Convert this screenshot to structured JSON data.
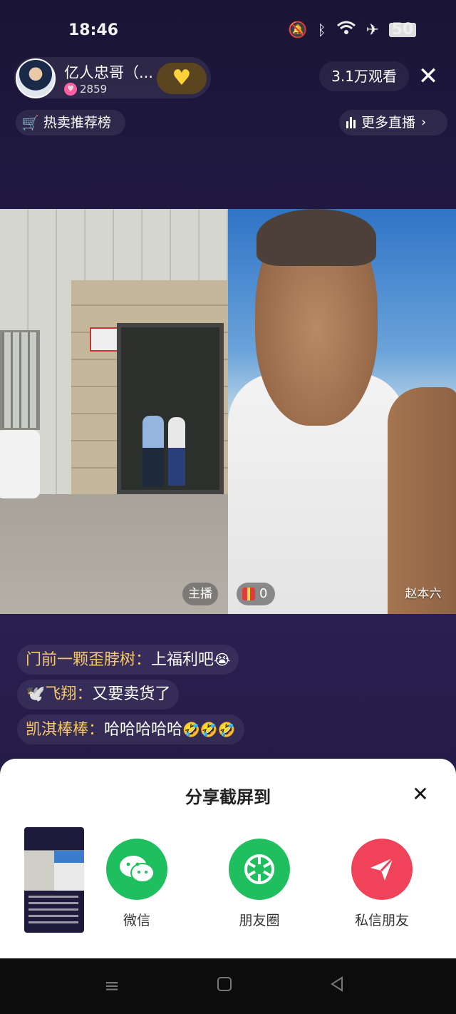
{
  "status_bar": {
    "time": "18:46",
    "battery": "50",
    "icons": [
      "mute-icon",
      "bluetooth-icon",
      "wifi-icon",
      "airplane-icon",
      "battery-icon"
    ]
  },
  "host": {
    "name": "亿人忠哥（...",
    "likes": "2859",
    "follow_icon": "heart-plus-icon"
  },
  "viewers": "3.1万观看",
  "hot_rank": "热卖推荐榜",
  "more_live": "更多直播",
  "video": {
    "host_tag": "主播",
    "gift_count": "0",
    "guest_name": "赵本六"
  },
  "comments": [
    {
      "user": "门前一颗歪脖树：",
      "message": "上福利吧",
      "emoji": "😭"
    },
    {
      "user": "🕊️飞翔：",
      "message": "又要卖货了",
      "emoji": ""
    },
    {
      "user": "凯淇棒棒：",
      "message": "哈哈哈哈哈",
      "emoji": "🤣🤣🤣"
    }
  ],
  "share_sheet": {
    "title": "分享截屏到",
    "options": [
      {
        "label": "微信",
        "icon": "wechat-icon",
        "color": "#1fbf5f"
      },
      {
        "label": "朋友圈",
        "icon": "moments-icon",
        "color": "#1fbf5f"
      },
      {
        "label": "私信朋友",
        "icon": "send-icon",
        "color": "#f0435a"
      }
    ]
  },
  "nav": [
    "menu-icon",
    "home-icon",
    "back-icon"
  ]
}
